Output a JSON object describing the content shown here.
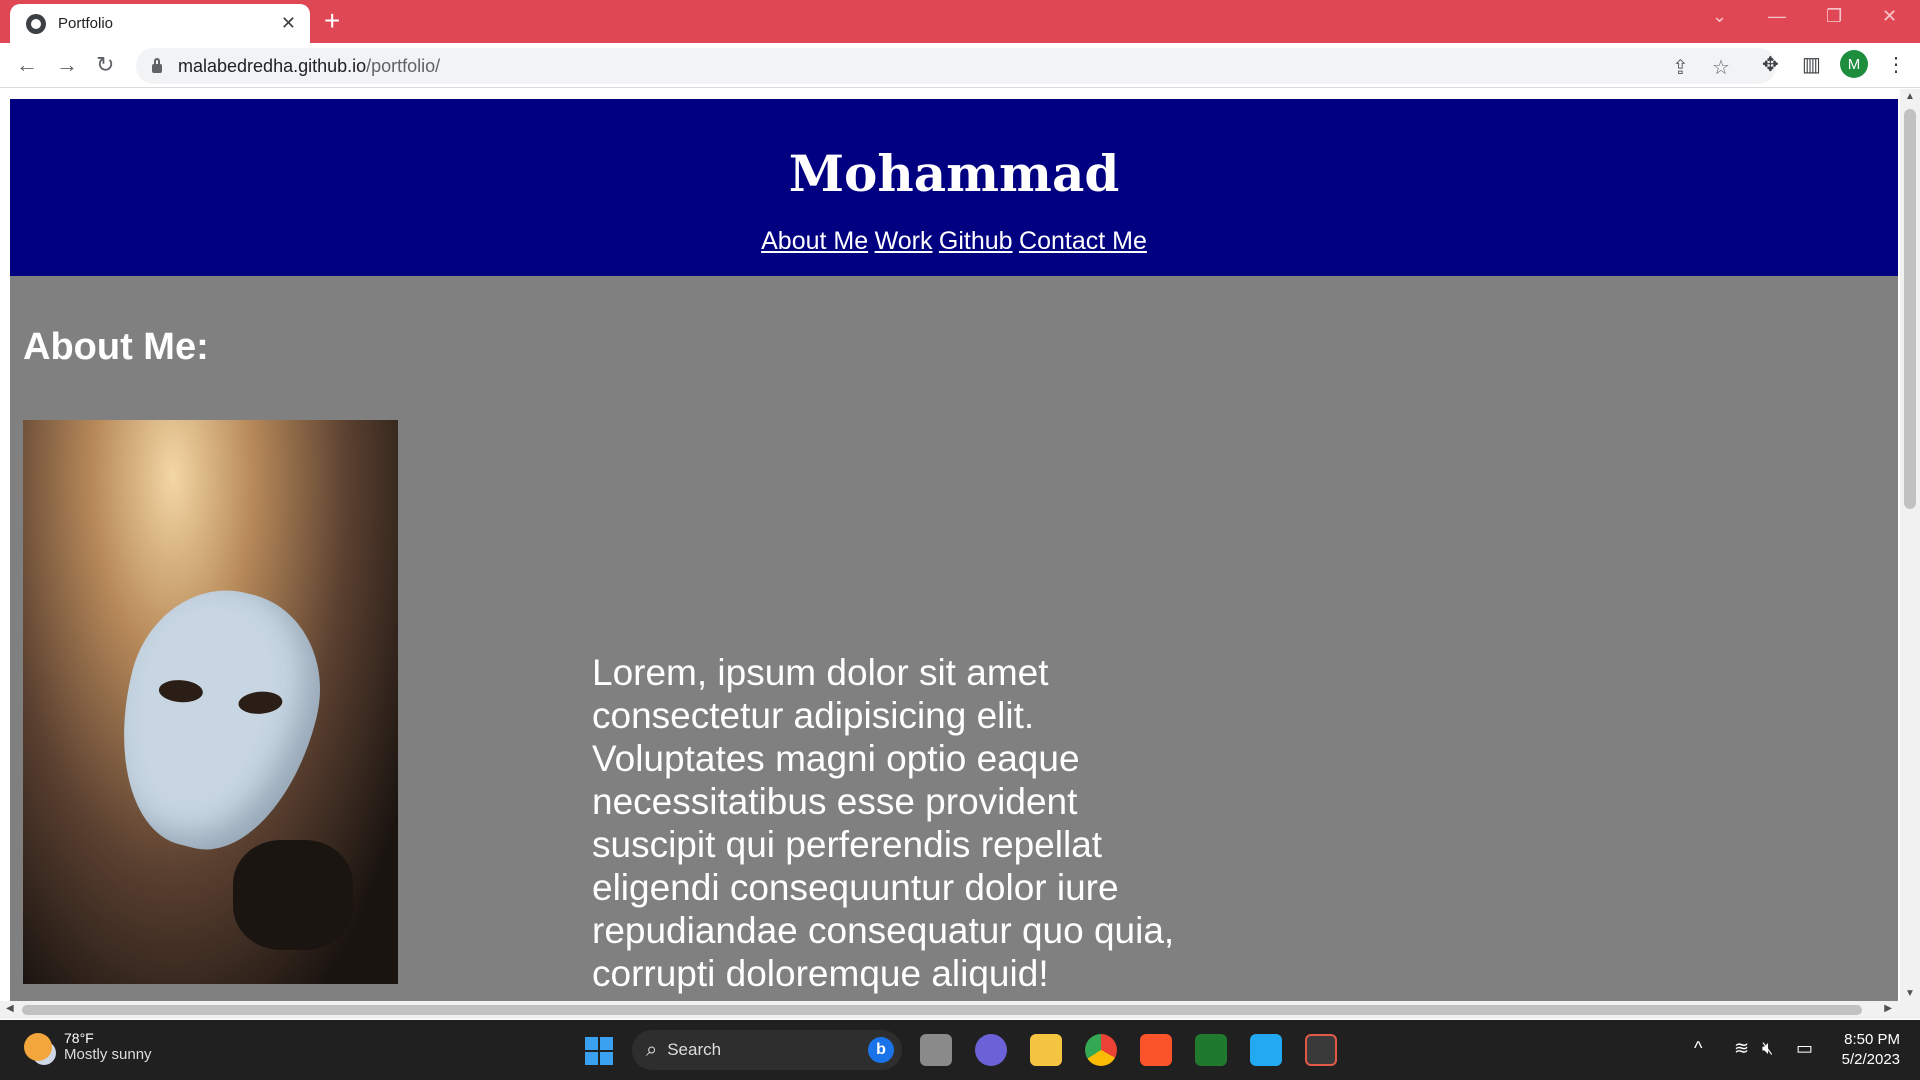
{
  "browser": {
    "tab_title": "Portfolio",
    "tab_close": "✕",
    "new_tab": "+",
    "url_host": "malabedredha.github.io",
    "url_path": "/portfolio/",
    "profile_initial": "M"
  },
  "site": {
    "title": "Mohammad",
    "nav": [
      "About Me",
      "Work",
      "Github",
      "Contact Me"
    ],
    "about_heading": "About Me:",
    "about_text": "Lorem, ipsum dolor sit amet consectetur adipisicing elit. Voluptates magni optio eaque necessitatibus esse provident suscipit qui perferendis repellat eligendi consequuntur dolor iure repudiandae consequatur quo quia, corrupti doloremque aliquid!"
  },
  "taskbar": {
    "weather_temp": "78°F",
    "weather_desc": "Mostly sunny",
    "search_label": "Search",
    "time": "8:50 PM",
    "date": "5/2/2023"
  },
  "colors": {
    "tab_strip": "#e04754",
    "header_bg": "#000080",
    "content_bg": "#808080"
  }
}
